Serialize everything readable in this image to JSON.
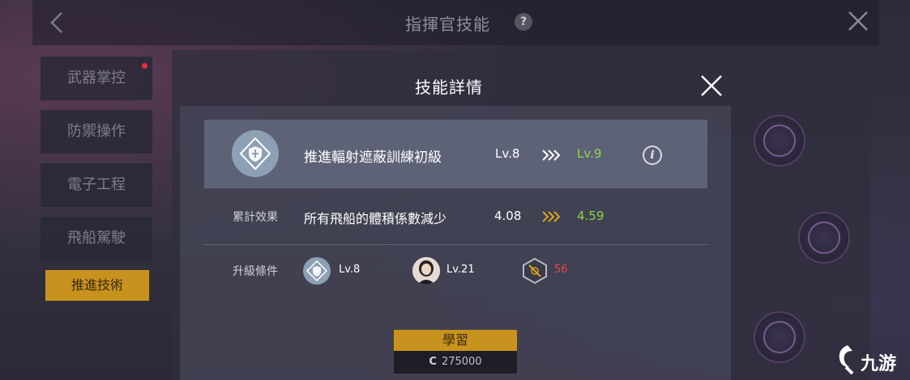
{
  "header": {
    "title": "指揮官技能",
    "help_icon": "?"
  },
  "sidebar": {
    "items": [
      {
        "label": "武器掌控",
        "badge": true
      },
      {
        "label": "防禦操作"
      },
      {
        "label": "電子工程"
      },
      {
        "label": "飛船駕駛"
      },
      {
        "label": "推進技術",
        "active": true
      }
    ]
  },
  "modal": {
    "title": "技能詳情",
    "skill": {
      "name": "推進輻射遮蔽訓練初級",
      "level_from": "Lv.8",
      "level_to": "Lv.9",
      "icon": "shield-skill-icon"
    },
    "effect": {
      "label": "累計效果",
      "text": "所有飛船的體積係數減少",
      "value_from": "4.08",
      "value_to": "4.59"
    },
    "requirements": {
      "label": "升級條件",
      "items": [
        {
          "icon": "shield-skill-icon",
          "text": "Lv.8"
        },
        {
          "icon": "commander-avatar",
          "text": "Lv.21"
        },
        {
          "icon": "research-point-icon",
          "text": "56",
          "insufficient": true
        }
      ]
    },
    "learn_button": "學習",
    "cost": {
      "currency": "C",
      "amount": "275000"
    }
  },
  "watermark": {
    "text": "九游"
  },
  "colors": {
    "accent_gold": "#c8921e",
    "upgrade_green": "#8bd64a",
    "insufficient_red": "#e84848"
  }
}
